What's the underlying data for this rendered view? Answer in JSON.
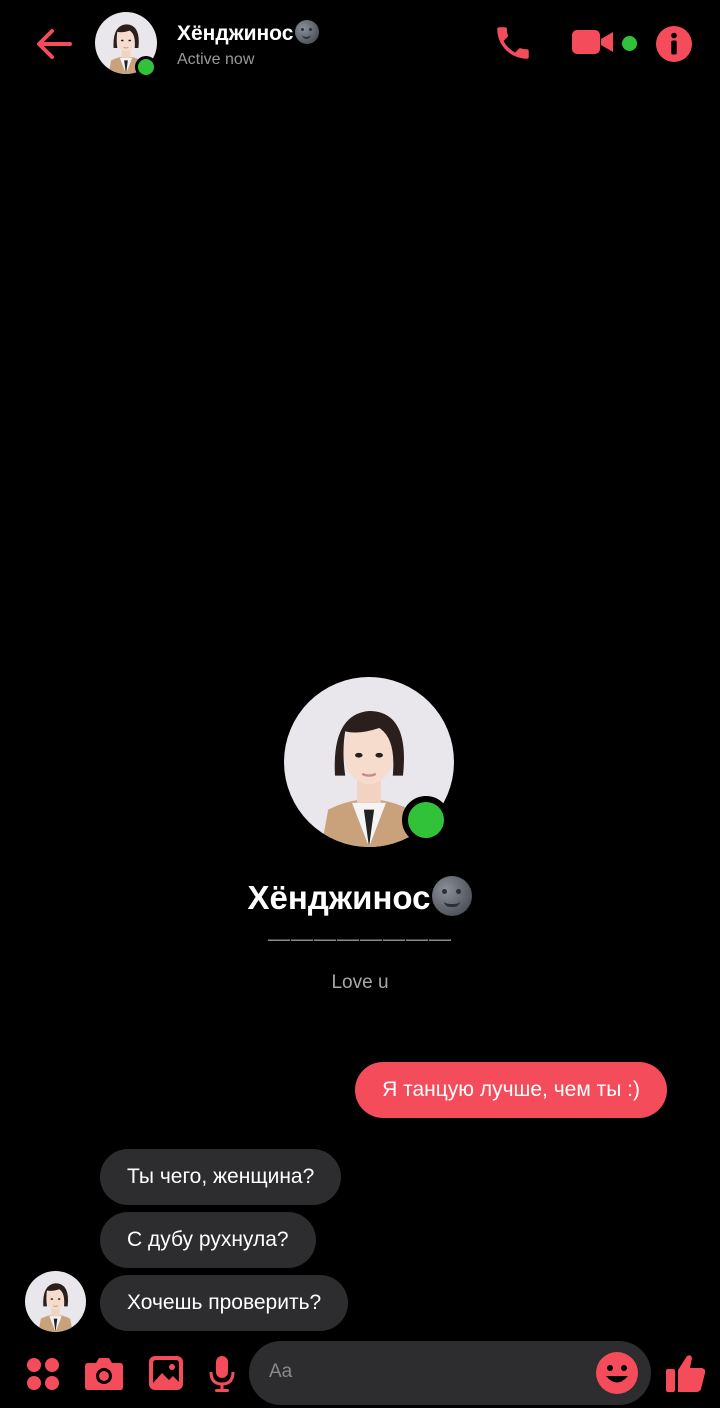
{
  "header": {
    "contact_name": "Хёнджинос",
    "status": "Active now"
  },
  "profile": {
    "name": "Хёнджинос",
    "divider": "————————",
    "bio": "Love u"
  },
  "messages": [
    {
      "direction": "outgoing",
      "text": "Я танцую лучше, чем ты :)"
    },
    {
      "direction": "incoming",
      "text": "Ты чего, женщина?"
    },
    {
      "direction": "incoming",
      "text": "С дубу рухнула?"
    },
    {
      "direction": "incoming",
      "text": "Хочешь проверить?"
    }
  ],
  "composer": {
    "placeholder": "Aa"
  },
  "colors": {
    "accent": "#f44c5a",
    "online": "#31c23a",
    "incoming_bubble": "#2d2d2f",
    "background": "#000000"
  },
  "icons": [
    "back-arrow-icon",
    "phone-icon",
    "video-camera-icon",
    "info-icon",
    "apps-grid-icon",
    "camera-icon",
    "gallery-icon",
    "microphone-icon",
    "emoji-icon",
    "thumbs-up-icon"
  ]
}
